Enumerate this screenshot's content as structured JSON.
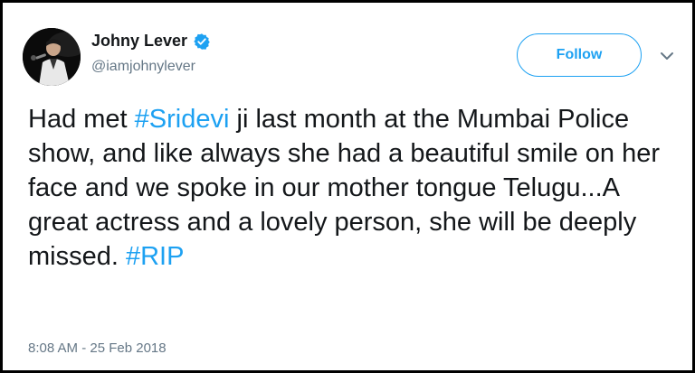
{
  "user": {
    "name": "Johny Lever",
    "handle": "@iamjohnylever",
    "verified": true,
    "avatar_icon": "performer-with-microphone-avatar"
  },
  "follow_label": "Follow",
  "more_icon": "chevron-down-icon",
  "tweet": {
    "part1": "Had met ",
    "hashtag1": "#Sridevi",
    "part2": " ji last month at the Mumbai Police show, and like always she had a beautiful smile on her face and we spoke in our mother tongue Telugu...A great actress and a lovely person, she will be deeply missed. ",
    "hashtag2": "#RIP"
  },
  "timestamp": "8:08 AM - 25 Feb 2018",
  "colors": {
    "accent": "#1da1f2",
    "text": "#14171a",
    "secondary": "#657786",
    "frame": "#000000"
  }
}
